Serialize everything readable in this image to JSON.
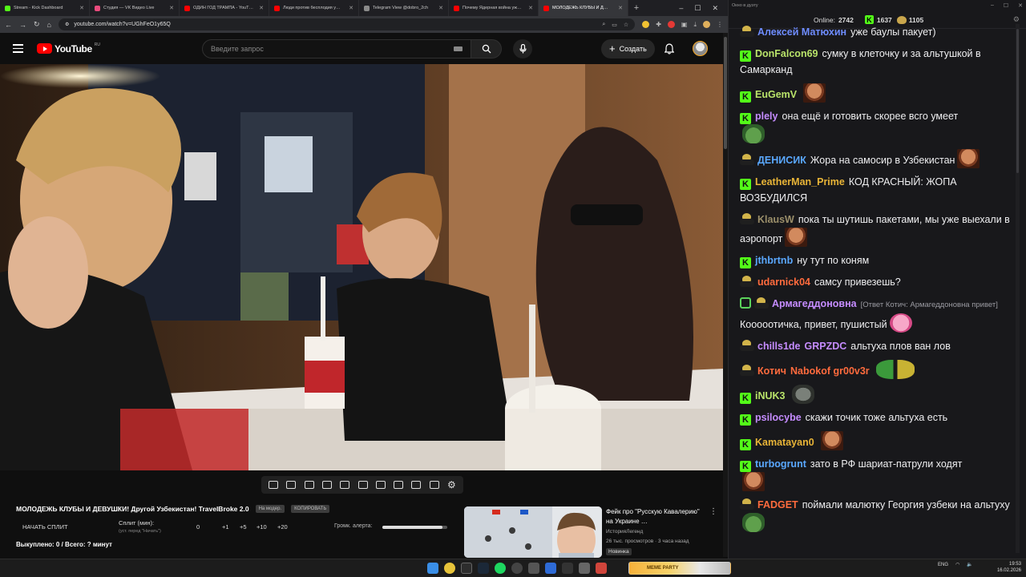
{
  "browser": {
    "tabs": [
      {
        "label": "Stream - Kick Dashboard",
        "color": "#53fc18",
        "active": false
      },
      {
        "label": "Студия — VK Видео Live",
        "color": "#e94b7d",
        "active": false
      },
      {
        "label": "ОДИН ГОД ТРАМПА - YouT…",
        "color": "#ff0000",
        "active": false
      },
      {
        "label": "Люди против бесплодия у…",
        "color": "#ff0000",
        "active": false
      },
      {
        "label": "Telegram View @dobro_2ch",
        "color": "#8a8a8a",
        "active": false
      },
      {
        "label": "Почему Ядерная война уж…",
        "color": "#ff0000",
        "active": false
      },
      {
        "label": "МОЛОДЕЖЬ КЛУБЫ И Д…",
        "color": "#ff0000",
        "active": true
      }
    ],
    "new_tab": "+",
    "url": "youtube.com/watch?v=UGhFeO1y65Q",
    "window_controls": [
      "–",
      "☐",
      "✕"
    ]
  },
  "youtube": {
    "logo_text": "YouTube",
    "logo_region": "RU",
    "search_placeholder": "Введите запрос",
    "create_label": "Создать",
    "video_title": "МОЛОДЕЖЬ КЛУБЫ И ДЕВУШКИ! Другой Узбекистан! TravelBroke 2.0",
    "chip_pending": "На модер.",
    "chip_copy": "КОПИРОВАТЬ",
    "split": {
      "start_label": "НАЧАТЬ СПЛИТ",
      "min_label": "Сплит (мин):",
      "hint": "(уст. перед \"Начать\")",
      "values": [
        "0",
        "+1",
        "+5",
        "+10",
        "+20"
      ],
      "alert_label": "Громк. алерта:",
      "alert_volume": 0.92
    },
    "bought": "Выкуплено: 0 / Всего: ? минут",
    "recommendation": {
      "title": "Фейк про \"Русскую Кавалерию\" на Украине …",
      "channel": "ИсторияЛегенд",
      "stats": "26 тыс. просмотров · 3 часа назад",
      "badge": "Новинка",
      "more": "⋮"
    }
  },
  "chat": {
    "window_title": "Окно в дуэту",
    "online_label": "Online:",
    "online_count": "2742",
    "kick_count": "1637",
    "emote_count": "1105",
    "messages": [
      {
        "user": "Алексей Матюхин",
        "color": "#6e8cff",
        "text": "уже баулы пакует)",
        "badge": "p"
      },
      {
        "user": "DonFalcon69",
        "color": "#b9e36a",
        "text": "сумку в клеточку и за альтушкой в Самарканд",
        "badge": "k"
      },
      {
        "user": "EuGemV",
        "color": "#b9e36a",
        "text": "",
        "badge": "k",
        "emote": "face"
      },
      {
        "user": "plely",
        "color": "#c58cff",
        "text": "она ещё и готовить скорее всго умеет",
        "badge": "k",
        "emote_next": "frog"
      },
      {
        "user": "ДЕНИСИК",
        "color": "#5aa8ff",
        "text": "Жора на самосир в Узбекистан",
        "badge": "p",
        "emote": "face"
      },
      {
        "user": "LeatherMan_Prime",
        "color": "#e8b437",
        "text": "КОД КРАСНЫЙ: ЖОПА ВОЗБУДИЛСЯ",
        "badge": "k"
      },
      {
        "user": "KlausW",
        "color": "#9b8f6a",
        "text": "пока ты шутишь пакетами, мы уже выехали в аэропорт",
        "badge": "p",
        "emote": "face"
      },
      {
        "user": "jthbrtnb",
        "color": "#5aa8ff",
        "text": "ну тут по коням",
        "badge": "k"
      },
      {
        "user": "udarnick04",
        "color": "#ff6b3d",
        "text": "самсу привезешь?",
        "badge": "p"
      },
      {
        "user": "Армагеддоновна",
        "color": "#c58cff",
        "reply": "[Ответ Котич: Армагеддоновна привет]",
        "text": "Кооооотичка, привет, пушистый",
        "badge": "s",
        "emote": "pink"
      },
      {
        "user": "chills1de",
        "user2": "GRPZDC",
        "color": "#c58cff",
        "color2": "#c58cff",
        "text": "альтуха плов ван лов",
        "badge": "p"
      },
      {
        "user": "Котич",
        "user2": "Nabokof gr00v3r",
        "color": "#ff6b3d",
        "color2": "#ff6b3d",
        "text": "",
        "badge": "p",
        "emote": "duo"
      },
      {
        "user": "iNUK3",
        "color": "#b9e36a",
        "text": "",
        "badge": "k",
        "emote": "gray"
      },
      {
        "user": "psilocybe",
        "color": "#c58cff",
        "text": "скажи точик тоже альтуха есть",
        "badge": "k"
      },
      {
        "user": "Kamatayan0",
        "color": "#e8b437",
        "text": "",
        "badge": "k",
        "emote": "face"
      },
      {
        "user": "turbogrunt",
        "color": "#5aa8ff",
        "text": "зато в РФ шариат-патрули ходят",
        "badge": "k",
        "emote_next": "face"
      },
      {
        "user": "FADGET",
        "color": "#ff6b3d",
        "text": "поймали малютку Георгия узбеки на альтуху",
        "badge": "p",
        "emote": "frog"
      }
    ]
  },
  "taskbar": {
    "meme_label": "MEME PARTY",
    "lang": "ENG",
    "time": "19:53",
    "date": "16.02.2026"
  }
}
